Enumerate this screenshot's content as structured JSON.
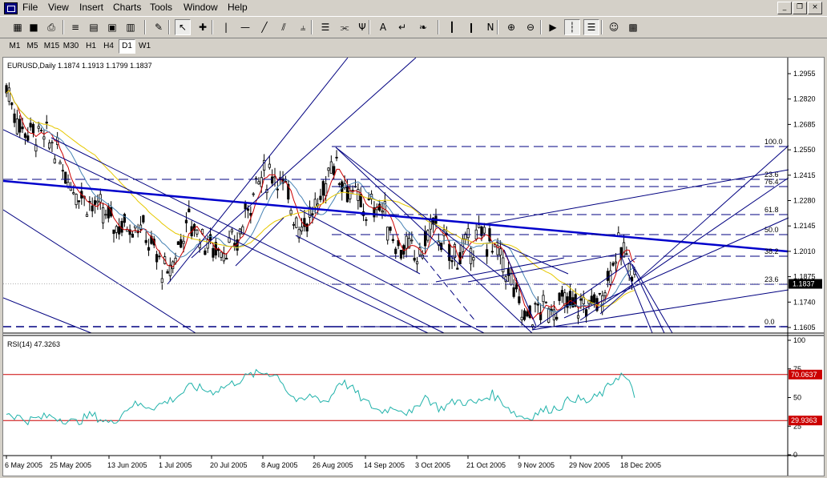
{
  "menu": [
    "File",
    "View",
    "Insert",
    "Charts",
    "Tools",
    "Window",
    "Help"
  ],
  "window_controls": [
    "_",
    "❐",
    "×"
  ],
  "toolbar": {
    "buttons": [
      {
        "name": "new-chart-icon",
        "glyph": "▦"
      },
      {
        "name": "save-icon",
        "glyph": "■"
      },
      {
        "name": "print-icon",
        "glyph": "⎙"
      },
      {
        "name": "market-watch-icon",
        "glyph": "≡"
      },
      {
        "name": "data-window-icon",
        "glyph": "▤"
      },
      {
        "name": "navigator-icon",
        "glyph": "▣"
      },
      {
        "name": "terminal-icon",
        "glyph": "▥"
      },
      {
        "name": "expert-advisors-icon",
        "glyph": "✎"
      },
      {
        "name": "cursor-icon",
        "glyph": "↖"
      },
      {
        "name": "crosshair-icon",
        "glyph": "✚"
      },
      {
        "name": "vertical-line-icon",
        "glyph": "|"
      },
      {
        "name": "horizontal-line-icon",
        "glyph": "—"
      },
      {
        "name": "trendline-icon",
        "glyph": "╱"
      },
      {
        "name": "channel-icon",
        "glyph": "⫽"
      },
      {
        "name": "gann-fan-icon",
        "glyph": "⫨"
      },
      {
        "name": "fibo-retracement-icon",
        "glyph": "☰"
      },
      {
        "name": "fibo-fan-icon",
        "glyph": "⫘"
      },
      {
        "name": "fibo-arcs-icon",
        "glyph": "Ψ"
      },
      {
        "name": "text-icon",
        "glyph": "A"
      },
      {
        "name": "label-icon",
        "glyph": "↵"
      },
      {
        "name": "wingdings-icon",
        "glyph": "❧"
      },
      {
        "name": "bar-chart-icon",
        "glyph": "┃"
      },
      {
        "name": "candlesticks-icon",
        "glyph": "❙"
      },
      {
        "name": "line-chart-icon",
        "glyph": "N"
      },
      {
        "name": "zoom-in-icon",
        "glyph": "⊕"
      },
      {
        "name": "zoom-out-icon",
        "glyph": "⊖"
      },
      {
        "name": "chart-shift-icon",
        "glyph": "▶"
      },
      {
        "name": "auto-scroll-icon",
        "glyph": "┆"
      },
      {
        "name": "periods-icon",
        "glyph": "☰"
      },
      {
        "name": "experts-icon",
        "glyph": "☺"
      },
      {
        "name": "history-center-icon",
        "glyph": "▩"
      },
      {
        "name": "options-icon",
        "glyph": "▩"
      }
    ]
  },
  "timeframes": [
    "M1",
    "M5",
    "M15",
    "M30",
    "H1",
    "H4",
    "D1",
    "W1"
  ],
  "active_timeframe": "D1",
  "main_chart": {
    "header": "EURUSD,Daily  1.1874 1.1913 1.1799 1.1837",
    "price_ticks": [
      "1.2955",
      "1.2820",
      "1.2685",
      "1.2550",
      "1.2415",
      "1.2280",
      "1.2145",
      "1.2010",
      "1.1875",
      "1.1740",
      "1.1605"
    ],
    "current_price": "1.1837",
    "fib_labels": [
      "100.0",
      "23.6",
      "76.4",
      "61.8",
      "50.0",
      "38.2",
      "23.6",
      "0.0"
    ]
  },
  "rsi": {
    "header": "RSI(14)  47.3263",
    "ticks": [
      "100",
      "75",
      "50",
      "25",
      "0"
    ],
    "level_high": "70.0637",
    "level_low": "29.9363"
  },
  "date_labels": [
    "6 May 2005",
    "25 May 2005",
    "13 Jun 2005",
    "1 Jul 2005",
    "20 Jul 2005",
    "8 Aug 2005",
    "26 Aug 2005",
    "14 Sep 2005",
    "3 Oct 2005",
    "21 Oct 2005",
    "9 Nov 2005",
    "29 Nov 2005",
    "18 Dec 2005"
  ],
  "colors": {
    "background": "#ffffff",
    "candles": "#000000",
    "ma_fast": "#cc0000",
    "ma_medium": "#4682b4",
    "ma_slow": "#e6c800",
    "objects": "#000080",
    "trendline": "#0000cc",
    "rsi_line": "#20b2aa",
    "rsi_levels": "#cc0000",
    "price_badge": "#000000"
  }
}
